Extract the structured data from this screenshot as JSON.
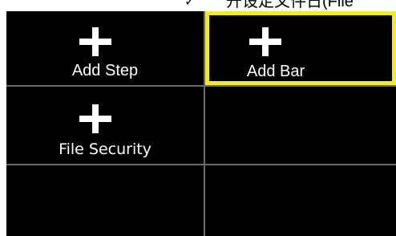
{
  "header": {
    "check_glyph": "✓",
    "partial_text": "开设定文件日(File"
  },
  "tiles": [
    {
      "label": "Add Step",
      "icon": "plus-icon"
    },
    {
      "label": "Add Bar",
      "icon": "plus-icon",
      "selected": true
    },
    {
      "label": "File Security",
      "icon": "plus-icon"
    }
  ],
  "colors": {
    "background": "#000000",
    "grid_line": "#6a6a6a",
    "selection": "#f5ee12",
    "text": "#ffffff"
  }
}
